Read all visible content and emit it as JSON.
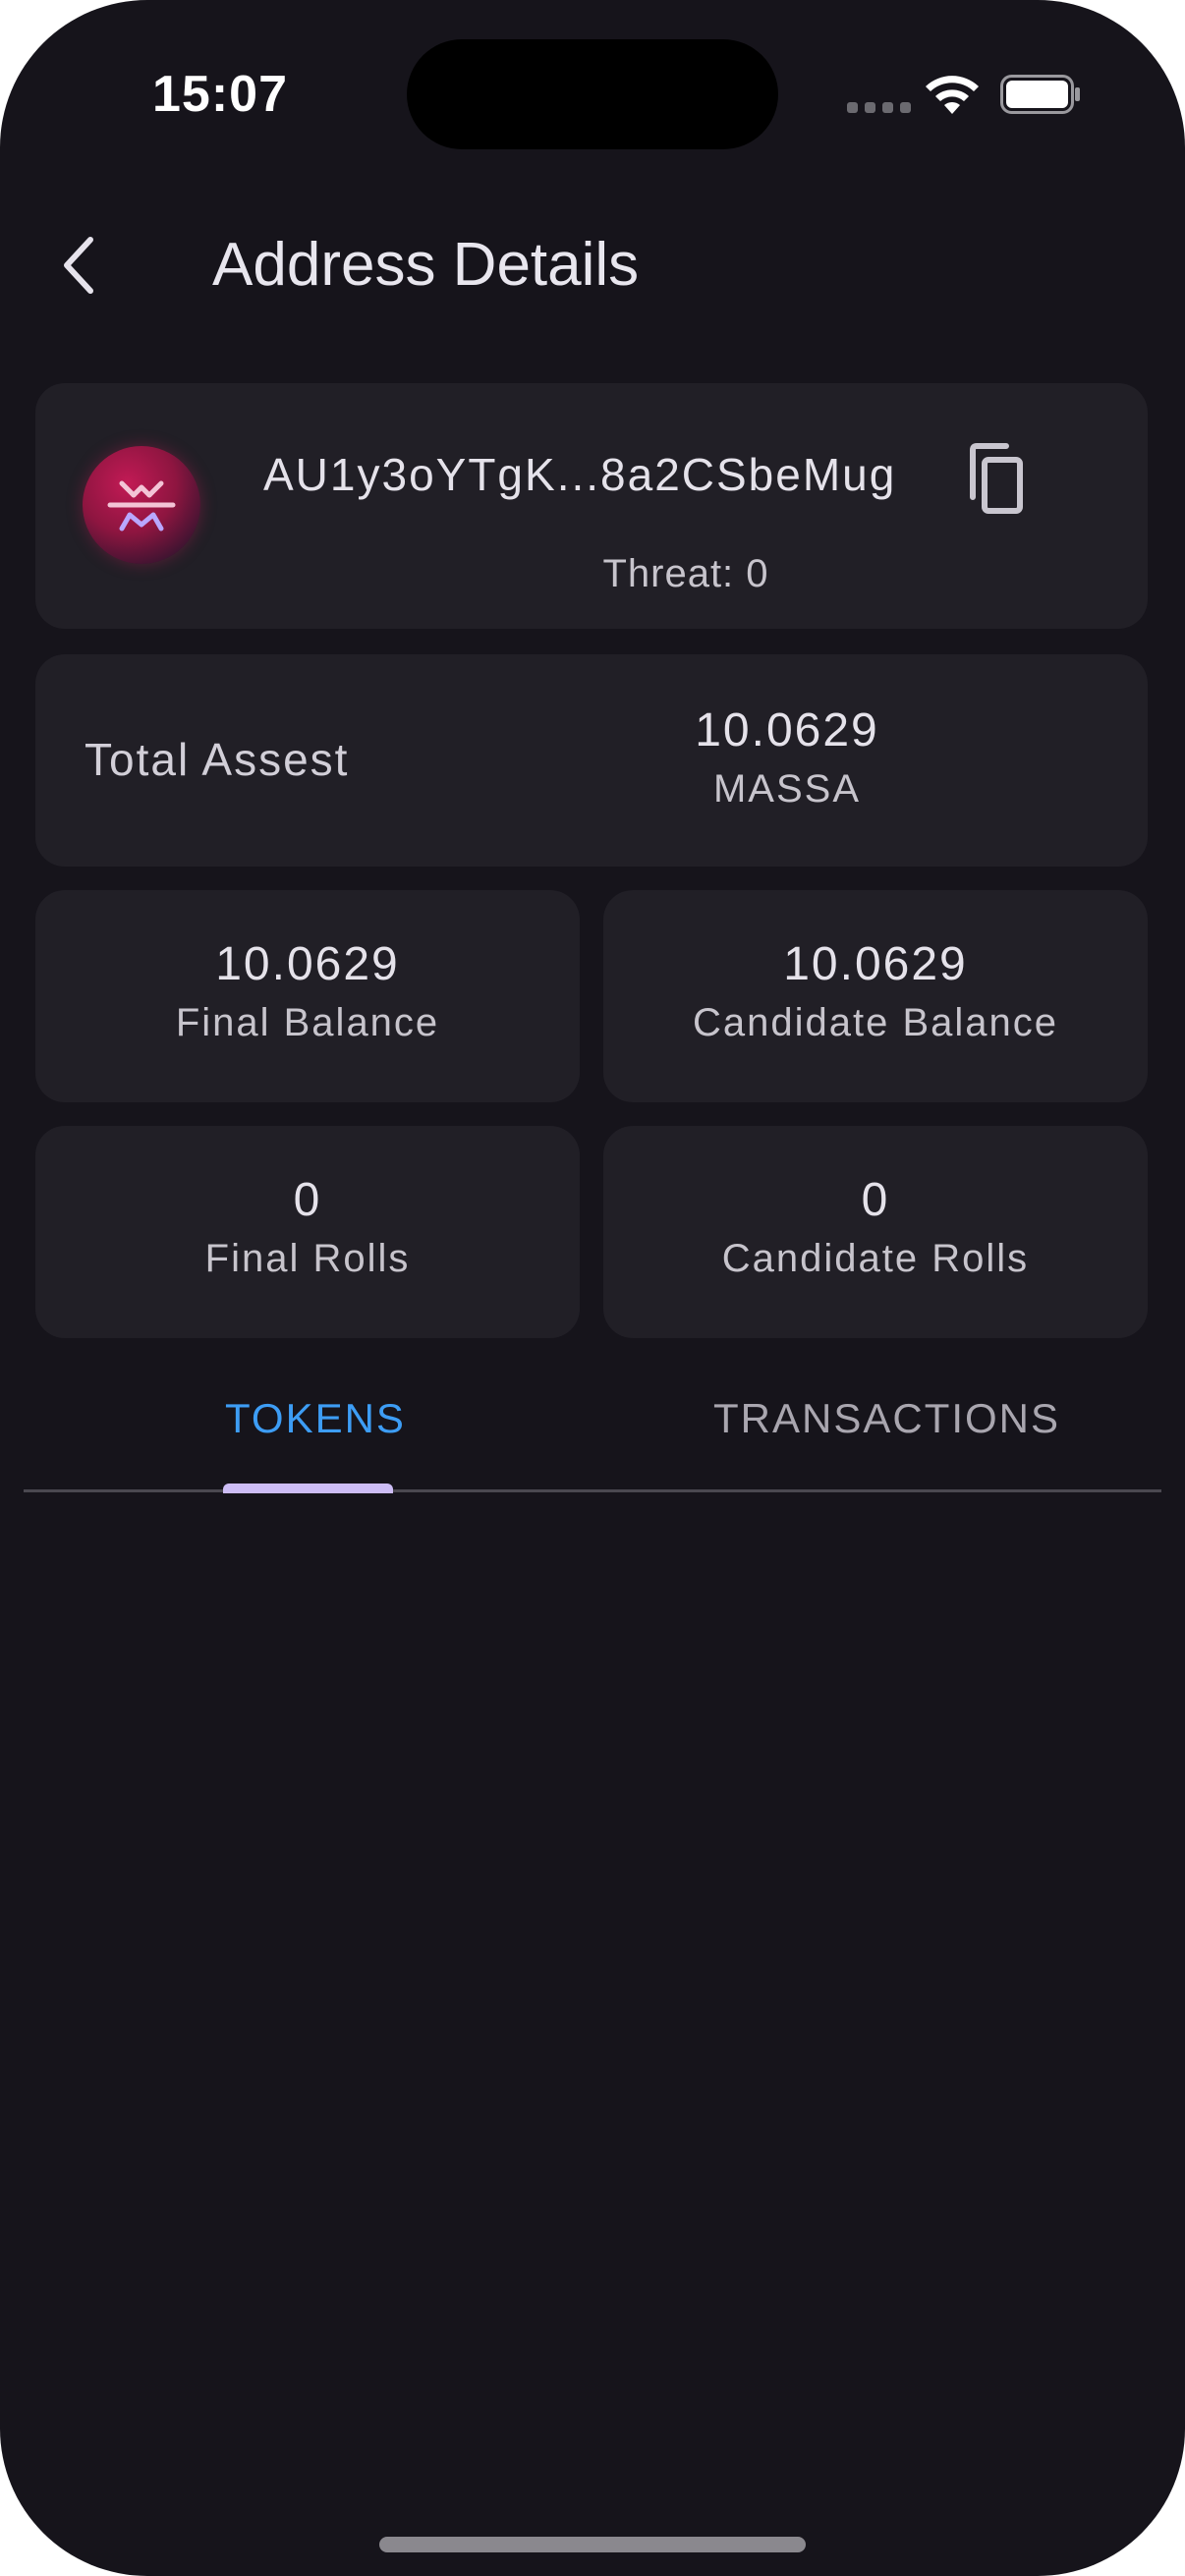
{
  "status_bar": {
    "time": "15:07"
  },
  "header": {
    "title": "Address Details",
    "back_icon": "chevron-left-icon"
  },
  "address_card": {
    "address": "AU1y3oYTgK...8a2CSbeMug",
    "threat": "Threat: 0",
    "avatar_icon": "massa-logo",
    "copy_icon": "copy-icon",
    "avatar_color": "#c21a55"
  },
  "total_assets": {
    "label": "Total Assest",
    "value": "10.0629",
    "unit": "MASSA"
  },
  "stats": {
    "final_balance": {
      "value": "10.0629",
      "label": "Final Balance"
    },
    "candidate_balance": {
      "value": "10.0629",
      "label": "Candidate Balance"
    },
    "final_rolls": {
      "value": "0",
      "label": "Final Rolls"
    },
    "candidate_rolls": {
      "value": "0",
      "label": "Candidate Rolls"
    }
  },
  "tabs": [
    {
      "label": "TOKENS",
      "active": true
    },
    {
      "label": "TRANSACTIONS",
      "active": false
    }
  ],
  "colors": {
    "background": "#16141b",
    "card": "#211f26",
    "active_tab": "#3d9df5",
    "indicator": "#cdbdf6"
  }
}
